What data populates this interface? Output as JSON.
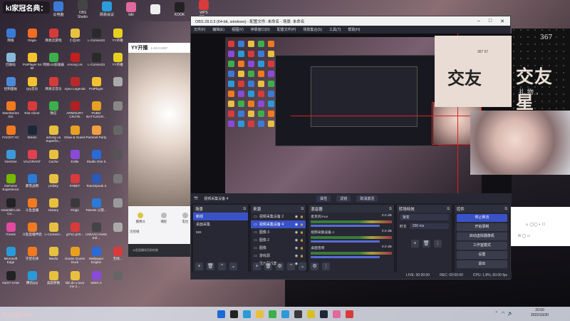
{
  "banner": "kI家冠名典：",
  "top_apps": [
    {
      "label": "云电脑",
      "color": "#3a7bd5"
    },
    {
      "label": "OBS Studio",
      "color": "#444"
    },
    {
      "label": "网易会议",
      "color": "#2b9bdb"
    },
    {
      "label": "kiki",
      "color": "#e06aa0"
    },
    {
      "label": "",
      "color": "#eee"
    },
    {
      "label": "KOOK",
      "color": "#222"
    },
    {
      "label": "WPS Office",
      "color": "#d83b3b"
    }
  ],
  "desktop_icons": [
    {
      "label": "网络",
      "color": "#3a7bd5"
    },
    {
      "label": "Origin",
      "color": "#f26b22"
    },
    {
      "label": "网易云游戏",
      "color": "#d43b3b"
    },
    {
      "label": "小丑3D",
      "color": "#e8c040"
    },
    {
      "label": "L-Connect3",
      "color": "#2a2a2a"
    },
    {
      "label": "YY开播",
      "color": "#e8d020"
    },
    {
      "label": "回收站",
      "color": "#8ab8d8"
    },
    {
      "label": "PotPlayer 64 bit",
      "color": "#f2c230"
    },
    {
      "label": "网易UU加速器",
      "color": "#3bb04a"
    },
    {
      "label": "Among Us",
      "color": "#c02020"
    },
    {
      "label": "L-Connect3",
      "color": "#2a2a2a"
    },
    {
      "label": "YY开播",
      "color": "#e8d020"
    },
    {
      "label": "控制面板",
      "color": "#4a8ad8"
    },
    {
      "label": "QQ音乐",
      "color": "#f2c230"
    },
    {
      "label": "网易云音乐",
      "color": "#d43b3b"
    },
    {
      "label": "Apex Legends",
      "color": "#b82a2a"
    },
    {
      "label": "PotPlayer",
      "color": "#f2c230"
    },
    {
      "label": "",
      "color": "#aaa"
    },
    {
      "label": "SteelSeries GG",
      "color": "#f07a20"
    },
    {
      "label": "Riot Client",
      "color": "#d83b3b"
    },
    {
      "label": "微信",
      "color": "#3bb04a"
    },
    {
      "label": "ARMOURY CRATE",
      "color": "#b02020"
    },
    {
      "label": "PUBG BATTLEGR...",
      "color": "#e8a020"
    },
    {
      "label": "",
      "color": "#888"
    },
    {
      "label": "FACEIT AC",
      "color": "#f07a20"
    },
    {
      "label": "Steam",
      "color": "#1b2838"
    },
    {
      "label": "among us Superhe...",
      "color": "#e8c040"
    },
    {
      "label": "Draw & Guess",
      "color": "#e8a020"
    },
    {
      "label": "Pummel Party",
      "color": "#f0a040"
    },
    {
      "label": "",
      "color": "#666"
    },
    {
      "label": "GeeGee",
      "color": "#3a9ad8"
    },
    {
      "label": "VALORANT",
      "color": "#e04050"
    },
    {
      "label": "Cache",
      "color": "#e8c040"
    },
    {
      "label": "Evilie",
      "color": "#8a4ad8"
    },
    {
      "label": "Studio One 5",
      "color": "#2a6ad8"
    },
    {
      "label": "",
      "color": "#555"
    },
    {
      "label": "GeForce Experience",
      "color": "#76b900"
    },
    {
      "label": "暴雪战网",
      "color": "#2a7ad8"
    },
    {
      "label": "prdisty",
      "color": "#e8c040"
    },
    {
      "label": "FABET",
      "color": "#d83b3b"
    },
    {
      "label": "TeamSpeak 3",
      "color": "#2a5ab8"
    },
    {
      "label": "",
      "color": "#777"
    },
    {
      "label": "Insta360 Link Co...",
      "color": "#222"
    },
    {
      "label": "斗鱼直播",
      "color": "#f07a20"
    },
    {
      "label": "History",
      "color": "#e8c040"
    },
    {
      "label": "Feign",
      "color": "#3a3a3a"
    },
    {
      "label": "ToDesk 以管...",
      "color": "#2a7ad8"
    },
    {
      "label": "",
      "color": "#999"
    },
    {
      "label": "iTunes",
      "color": "#e04aa0"
    },
    {
      "label": "斗鱼直播伴侣",
      "color": "#f07a20"
    },
    {
      "label": "L-Connect...",
      "color": "#e8c040"
    },
    {
      "label": "gt711-p20...",
      "color": "#d83b3b"
    },
    {
      "label": "UsbAAn Hosts Edi...",
      "color": "#444"
    },
    {
      "label": "",
      "color": "#aaa"
    },
    {
      "label": "Microsoft Edge",
      "color": "#2a9ad8"
    },
    {
      "label": "守望先锋",
      "color": "#f07a20"
    },
    {
      "label": "Media",
      "color": "#e8c040"
    },
    {
      "label": "Goose Goose Duck",
      "color": "#e8a020"
    },
    {
      "label": "Wallpaper Engine",
      "color": "#2a6ad8"
    },
    {
      "label": "无线...",
      "color": "#d83b3b"
    },
    {
      "label": "NZXT CAM",
      "color": "#222"
    },
    {
      "label": "腾讯QQ",
      "color": "#2a9ad8"
    },
    {
      "label": "美颜参数",
      "color": "#e8c040"
    },
    {
      "label": "kiki do u love me 2...",
      "color": "#e8c040"
    },
    {
      "label": "Witch It",
      "color": "#8a4ad8"
    },
    {
      "label": "",
      "color": "#666"
    }
  ],
  "yy": {
    "title": "YY开播",
    "version": "1.43.0.2297",
    "controls": [
      "摄像头",
      "捕捉",
      "电台"
    ],
    "tip": "连接播",
    "foot": "斗鱼直播伴侣前的跑"
  },
  "obs": {
    "title": "OBS 28.0.3 (64-bit, windows) - 配置文件: 未命名 - 场景: 未命名",
    "window_controls": [
      "–",
      "□",
      "✕"
    ],
    "menu": [
      "文件(F)",
      "编辑(E)",
      "视图(V)",
      "停靠窗口(D)",
      "配置文件(P)",
      "场景集合(S)",
      "工具(T)",
      "帮助(H)"
    ],
    "source_bar": {
      "source_name": "视频采集设备 4",
      "props": "属性",
      "filters": "滤镜",
      "deactivate": "取消激活"
    },
    "docks": {
      "scenes": {
        "title": "场景",
        "items": [
          "新线",
          "桌面采集",
          "sss"
        ],
        "selected": 0
      },
      "sources": {
        "title": "来源",
        "items": [
          "视频采集设备 2",
          "视频采集设备 4",
          "图像 3",
          "图像 2",
          "图像",
          "游戏源",
          "显示器采集"
        ],
        "selected": 1
      },
      "mixer": {
        "title": "混音器",
        "rows": [
          {
            "name": "麦克风/Aux",
            "db": "0.0 dB"
          },
          {
            "name": "视频采集设备 4",
            "db": "0.0 dB"
          },
          {
            "name": "桌面音频",
            "db": "0.0 dB"
          }
        ]
      },
      "transitions": {
        "title": "转场特效",
        "mode": "渐变",
        "duration_label": "时长",
        "duration": "200 ms"
      },
      "controls": {
        "title": "控件",
        "buttons": [
          "停止推流",
          "开始录制",
          "启动虚拟摄像机",
          "工作室模式",
          "设置",
          "退出"
        ]
      }
    },
    "status": {
      "live": "LIVE: 00:00:00",
      "rec": "REC: 00:00:00",
      "cpu": "CPU: 1.8%, 60.00 fps"
    },
    "preview_label": "1080p"
  },
  "right": {
    "poster_big": "交友星",
    "poster_small": "367",
    "poster_sub": "礼 物 ，",
    "partial_cn": "交友",
    "partial_num": "367 67"
  },
  "chat": {
    "row1": "☺ ◯◯ ◐ ☐",
    "row2": "✉ ◯ ▭"
  },
  "bottom_brand": "KIKI仔ovo",
  "clock": {
    "time": "20:00",
    "date": "2022/10/30"
  },
  "taskbar_colors": [
    "#1a6ad8",
    "#222",
    "#2a9ad8",
    "#e8c040",
    "#3bb04a",
    "#2a9ad8",
    "#3a3a3a",
    "#d8c020",
    "#1b2838",
    "#e06aa0",
    "#d83b3b"
  ]
}
